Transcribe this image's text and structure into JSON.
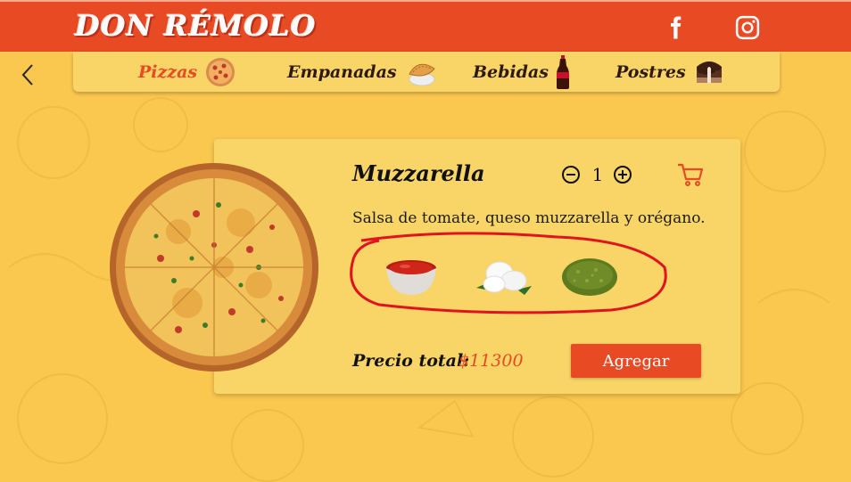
{
  "brand": {
    "logo_text": "DON RÉMOLO"
  },
  "header": {
    "social": [
      "facebook-icon",
      "instagram-icon"
    ]
  },
  "nav": {
    "items": [
      {
        "label": "Pizzas",
        "icon": "pizza-icon",
        "active": true
      },
      {
        "label": "Empanadas",
        "icon": "empanada-icon",
        "active": false
      },
      {
        "label": "Bebidas",
        "icon": "soda-bottle-icon",
        "active": false
      },
      {
        "label": "Postres",
        "icon": "dessert-icon",
        "active": false
      }
    ]
  },
  "product": {
    "name": "Muzzarella",
    "quantity": "1",
    "description": "Salsa de tomate, queso muzzarella y orégano.",
    "ingredients": [
      "tomato-sauce-icon",
      "mozzarella-icon",
      "oregano-icon"
    ],
    "price_label": "Precio total:",
    "price_value": "$11300",
    "add_button": "Agregar"
  },
  "colors": {
    "accent": "#e84a24",
    "background": "#fbc84f",
    "card": "#f9d466"
  }
}
